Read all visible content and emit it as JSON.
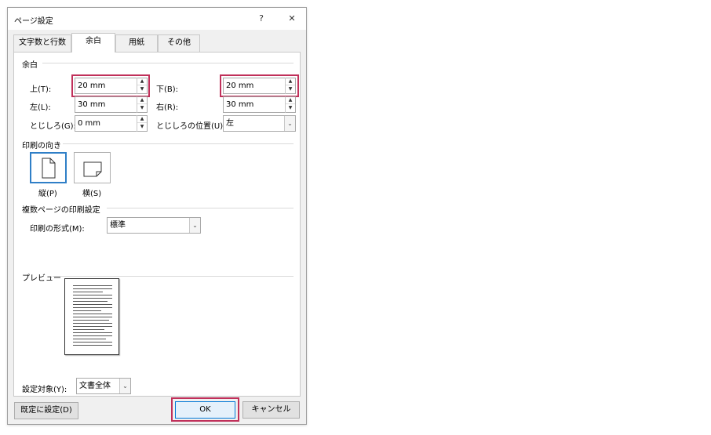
{
  "window": {
    "title": "ページ設定",
    "help_glyph": "?",
    "close_glyph": "✕"
  },
  "tabs": [
    {
      "label": "文字数と行数"
    },
    {
      "label": "余白"
    },
    {
      "label": "用紙"
    },
    {
      "label": "その他"
    }
  ],
  "margins": {
    "section": "余白",
    "top": {
      "label": "上(T):",
      "value": "20 mm"
    },
    "bottom": {
      "label": "下(B):",
      "value": "20 mm"
    },
    "left": {
      "label": "左(L):",
      "value": "30 mm"
    },
    "right": {
      "label": "右(R):",
      "value": "30 mm"
    },
    "gutter": {
      "label": "とじしろ(G):",
      "value": "0 mm"
    },
    "gutter_pos": {
      "label": "とじしろの位置(U):",
      "value": "左"
    }
  },
  "orientation": {
    "section": "印刷の向き",
    "portrait": "縦(P)",
    "landscape": "横(S)"
  },
  "multipage": {
    "section": "複数ページの印刷設定",
    "label": "印刷の形式(M):",
    "value": "標準"
  },
  "preview": {
    "section": "プレビュー"
  },
  "apply": {
    "label": "設定対象(Y):",
    "value": "文書全体"
  },
  "buttons": {
    "default": "既定に設定(D)",
    "ok": "OK",
    "cancel": "キャンセル"
  },
  "colors": {
    "highlight": "#c0305a",
    "selection": "#2f7fc7"
  }
}
